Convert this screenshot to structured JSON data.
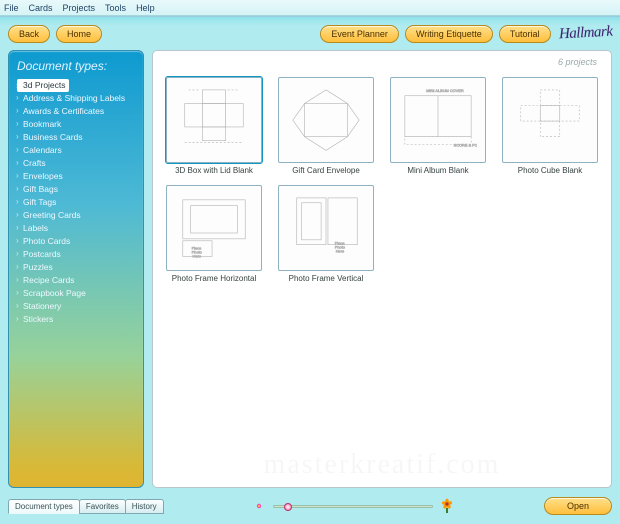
{
  "menu": {
    "items": [
      "File",
      "Cards",
      "Projects",
      "Tools",
      "Help"
    ]
  },
  "toolbar": {
    "back": "Back",
    "home": "Home",
    "event_planner": "Event Planner",
    "writing_etiquette": "Writing Etiquette",
    "tutorial": "Tutorial"
  },
  "brand": "Hallmark",
  "sidebar": {
    "title": "Document types:",
    "selected_index": 0,
    "items": [
      "3d Projects",
      "Address & Shipping Labels",
      "Awards & Certificates",
      "Bookmark",
      "Business Cards",
      "Calendars",
      "Crafts",
      "Envelopes",
      "Gift Bags",
      "Gift Tags",
      "Greeting Cards",
      "Labels",
      "Photo Cards",
      "Postcards",
      "Puzzles",
      "Recipe Cards",
      "Scrapbook Page",
      "Stationery",
      "Stickers"
    ]
  },
  "content": {
    "count_label": "6  projects",
    "projects": [
      "3D Box with Lid Blank",
      "Gift Card Envelope",
      "Mini Album Blank",
      "Photo Cube Blank",
      "Photo Frame Horizontal",
      "Photo Frame Vertical"
    ]
  },
  "tabs": {
    "items": [
      "Document types",
      "Favorites",
      "History"
    ],
    "active": 0
  },
  "footer": {
    "open": "Open"
  },
  "watermark": "masterkreatif.com"
}
